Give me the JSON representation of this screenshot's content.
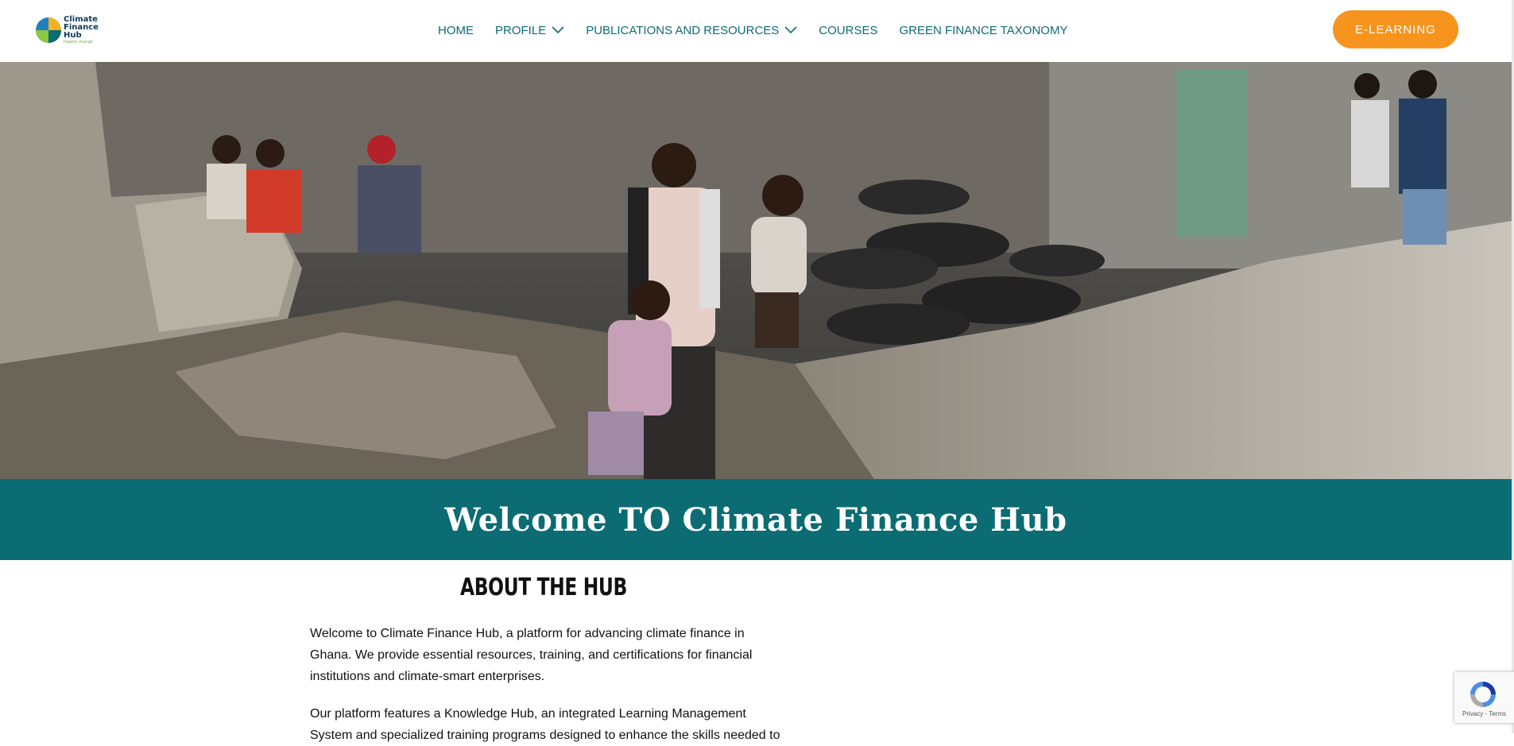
{
  "brand": {
    "logo_line1": "Climate",
    "logo_line2": "Finance",
    "logo_line3": "Hub",
    "logo_tagline": "Inspire change",
    "colors": {
      "teal": "#0b6c73",
      "nav_text": "#0e6c73",
      "orange": "#f7941d"
    }
  },
  "nav": {
    "items": [
      {
        "label": "HOME",
        "dropdown": false
      },
      {
        "label": "PROFILE",
        "dropdown": true,
        "icon": "chevron-down-icon"
      },
      {
        "label": "PUBLICATIONS AND RESOURCES",
        "dropdown": true,
        "icon": "chevron-down-icon"
      },
      {
        "label": "COURSES",
        "dropdown": false
      },
      {
        "label": "GREEN FINANCE TAXONOMY",
        "dropdown": false
      }
    ],
    "cta_label": "E-LEARNING"
  },
  "hero": {
    "banner_title": "Welcome TO Climate Finance Hub"
  },
  "about": {
    "title": "ABOUT THE HUB",
    "paragraph1": "Welcome to Climate Finance Hub, a platform for advancing climate finance in Ghana. We provide essential resources, training, and certifications for financial institutions and climate-smart enterprises.",
    "paragraph2": "Our platform features a Knowledge Hub, an integrated Learning Management System and specialized training programs designed to enhance the skills needed to"
  },
  "recaptcha": {
    "links": "Privacy - Terms",
    "icon": "recaptcha-icon"
  }
}
